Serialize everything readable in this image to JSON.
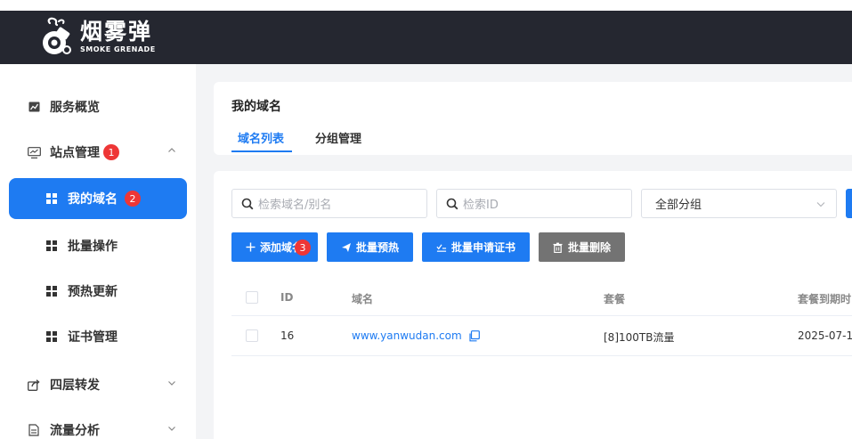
{
  "brand": {
    "name_cn": "烟雾弹",
    "name_en": "SMOKE GRENADE"
  },
  "sidebar": {
    "items": [
      {
        "label": "服务概览",
        "icon": "chart-line-icon"
      },
      {
        "label": "站点管理",
        "icon": "monitor-icon",
        "badge": "1",
        "expanded": true
      },
      {
        "label": "我的域名",
        "icon": "grid-icon",
        "badge": "2",
        "active": true
      },
      {
        "label": "批量操作",
        "icon": "grid-icon"
      },
      {
        "label": "预热更新",
        "icon": "grid-icon"
      },
      {
        "label": "证书管理",
        "icon": "grid-icon"
      },
      {
        "label": "四层转发",
        "icon": "share-icon"
      },
      {
        "label": "流量分析",
        "icon": "document-icon"
      }
    ]
  },
  "header": {
    "title": "我的域名",
    "tabs": [
      {
        "label": "域名列表",
        "active": true
      },
      {
        "label": "分组管理",
        "active": false
      }
    ]
  },
  "filters": {
    "search_domain_placeholder": "检索域名/别名",
    "search_id_placeholder": "检索ID",
    "group_select_value": "全部分组"
  },
  "toolbar": {
    "add_domain": "添加域名",
    "add_domain_badge": "3",
    "batch_prefetch": "批量预热",
    "batch_cert": "批量申请证书",
    "batch_delete": "批量删除"
  },
  "table": {
    "columns": [
      "ID",
      "域名",
      "套餐",
      "套餐到期时"
    ],
    "rows": [
      {
        "id": "16",
        "domain": "www.yanwudan.com",
        "plan": "[8]100TB流量",
        "expiry": "2025-07-1"
      }
    ]
  },
  "colors": {
    "primary": "#1e7bf2",
    "topbar": "#252730",
    "badge": "#ee3636",
    "delete_button": "#737373"
  }
}
